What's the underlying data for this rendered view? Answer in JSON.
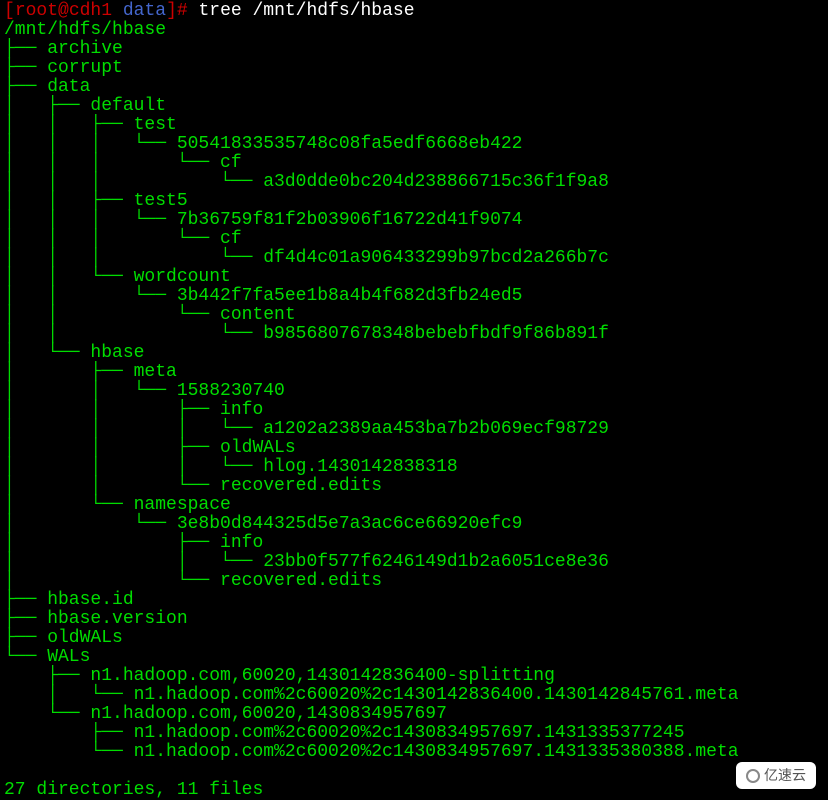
{
  "prompt": {
    "user_host": "root@cdh1",
    "cwd": "data",
    "command": "tree /mnt/hdfs/hbase"
  },
  "output": {
    "root_path": "/mnt/hdfs/hbase",
    "tree_lines": [
      "├── archive",
      "├── corrupt",
      "├── data",
      "│   ├── default",
      "│   │   ├── test",
      "│   │   │   └── 50541833535748c08fa5edf6668eb422",
      "│   │   │       └── cf",
      "│   │   │           └── a3d0dde0bc204d238866715c36f1f9a8",
      "│   │   ├── test5",
      "│   │   │   └── 7b36759f81f2b03906f16722d41f9074",
      "│   │   │       └── cf",
      "│   │   │           └── df4d4c01a906433299b97bcd2a266b7c",
      "│   │   └── wordcount",
      "│   │       └── 3b442f7fa5ee1b8a4b4f682d3fb24ed5",
      "│   │           └── content",
      "│   │               └── b9856807678348bebebfbdf9f86b891f",
      "│   └── hbase",
      "│       ├── meta",
      "│       │   └── 1588230740",
      "│       │       ├── info",
      "│       │       │   └── a1202a2389aa453ba7b2b069ecf98729",
      "│       │       ├── oldWALs",
      "│       │       │   └── hlog.1430142838318",
      "│       │       └── recovered.edits",
      "│       └── namespace",
      "│           └── 3e8b0d844325d5e7a3ac6ce66920efc9",
      "│               ├── info",
      "│               │   └── 23bb0f577f6246149d1b2a6051ce8e36",
      "│               └── recovered.edits",
      "├── hbase.id",
      "├── hbase.version",
      "├── oldWALs",
      "└── WALs",
      "    ├── n1.hadoop.com,60020,1430142836400-splitting",
      "    │   └── n1.hadoop.com%2c60020%2c1430142836400.1430142845761.meta",
      "    └── n1.hadoop.com,60020,1430834957697",
      "        ├── n1.hadoop.com%2c60020%2c1430834957697.1431335377245",
      "        └── n1.hadoop.com%2c60020%2c1430834957697.1431335380388.meta"
    ],
    "summary": "27 directories, 11 files"
  },
  "watermark": {
    "text": "亿速云"
  }
}
